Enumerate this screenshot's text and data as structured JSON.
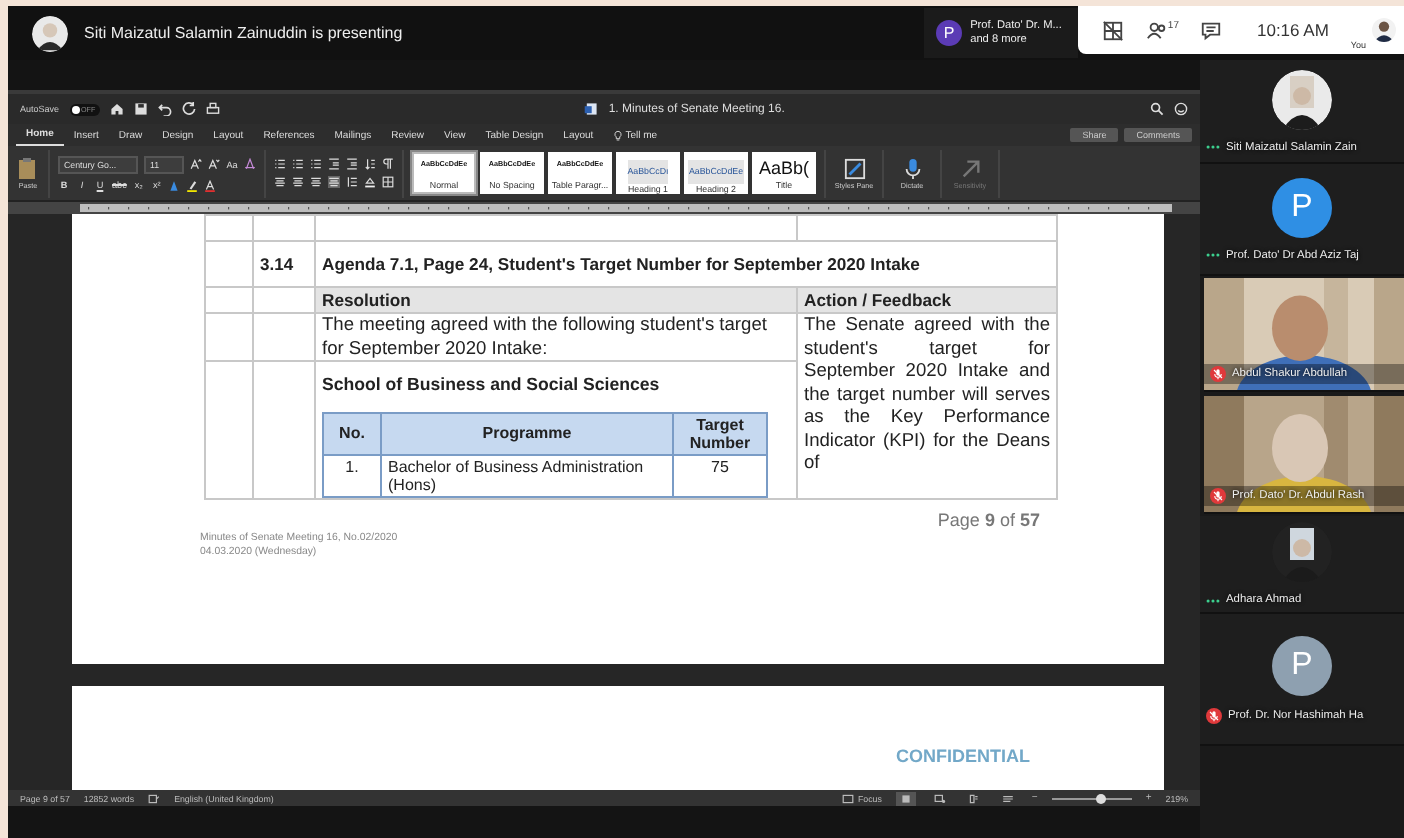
{
  "presenter_bar": {
    "text": "Siti Maizatul Salamin Zainuddin is presenting"
  },
  "speaker_chip": {
    "initial": "P",
    "name": "Prof. Dato' Dr. M...",
    "more": "and 8 more"
  },
  "meeting_controls": {
    "participant_count": "17",
    "time": "10:16 AM",
    "self_label": "You"
  },
  "word": {
    "title_bar": {
      "autosave_label": "AutoSave",
      "autosave": {
        "on": false,
        "label": "OFF"
      },
      "title": "1. Minutes of Senate Meeting 16."
    },
    "tabs": [
      {
        "label": "Home",
        "selected": true
      },
      {
        "label": "Insert",
        "selected": false
      },
      {
        "label": "Draw",
        "selected": false
      },
      {
        "label": "Design",
        "selected": false
      },
      {
        "label": "Layout",
        "selected": false
      },
      {
        "label": "References",
        "selected": false
      },
      {
        "label": "Mailings",
        "selected": false
      },
      {
        "label": "Review",
        "selected": false
      },
      {
        "label": "View",
        "selected": false
      },
      {
        "label": "Table Design",
        "selected": false
      },
      {
        "label": "Layout",
        "selected": false
      }
    ],
    "tell_me": "Tell me",
    "share": "Share",
    "comments": "Comments",
    "ribbon": {
      "paste": "Paste",
      "font": "Century Go...",
      "size": "11",
      "case": "Aa",
      "format_buttons": [
        "B",
        "I",
        "U",
        "abc",
        "x₂",
        "x²"
      ],
      "styles": [
        {
          "preview": "AaBbCcDdEe",
          "name": "Normal",
          "selected": true
        },
        {
          "preview": "AaBbCcDdEe",
          "name": "No Spacing",
          "selected": false
        },
        {
          "preview": "AaBbCcDdEe",
          "name": "Table Paragr...",
          "selected": false
        },
        {
          "preview": "AaBbCcDı",
          "name": "Heading 1",
          "selected": false
        },
        {
          "preview": "AaBbCcDdEe",
          "name": "Heading 2",
          "selected": false
        },
        {
          "preview": "AaBb(",
          "name": "Title",
          "selected": false
        }
      ],
      "styles_pane": "Styles Pane",
      "dictate": "Dictate",
      "sensitivity": "Sensitivity"
    },
    "document": {
      "agenda": {
        "number": "3.14",
        "title": "Agenda 7.1, Page 24, Student's Target Number for September 2020 Intake"
      },
      "resolution_heading": "Resolution",
      "action_heading": "Action / Feedback",
      "resolution_text": "The meeting agreed with the following student's target for September 2020 Intake:",
      "school": "School of Business and Social Sciences",
      "programme_table": {
        "columns": [
          "No.",
          "Programme",
          "Target Number"
        ],
        "rows": [
          [
            "1.",
            "Bachelor of Business Administration (Hons)",
            "75"
          ]
        ]
      },
      "action_text": "The Senate agreed with the student's target for September 2020 Intake and the target number will serves as the Key Performance Indicator (KPI) for the Deans of",
      "page_number": "Page **9** of **57**",
      "footer": [
        "Minutes of Senate Meeting 16, No.02/2020",
        "04.03.2020 (Wednesday)"
      ],
      "next_page_mark": "CONFIDENTIAL"
    },
    "status_bar": {
      "page": "Page 9 of 57",
      "words": "12852 words",
      "language": "English (United Kingdom)",
      "focus": "Focus",
      "views": [
        {
          "selected": true
        },
        {
          "selected": false
        },
        {
          "selected": false
        },
        {
          "selected": false
        }
      ],
      "zoom": {
        "minus": "−",
        "plus": "+",
        "level": 0.62,
        "reading": "219%"
      }
    }
  },
  "participants": [
    {
      "name": "Siti Maizatul Salamin Zain",
      "muted": false
    },
    {
      "name": "Prof. Dato' Dr Abd Aziz Taj",
      "kind": "initial",
      "initial": "P",
      "color": "#2f8fe4",
      "muted": false
    },
    {
      "name": "Abdul Shakur Abdullah",
      "kind": "video",
      "muted": true
    },
    {
      "name": "Prof. Dato' Dr. Abdul Rash",
      "kind": "video",
      "muted": true
    },
    {
      "name": "Adhara Ahmad",
      "muted": false
    },
    {
      "name": "Prof. Dr. Nor Hashimah Ha",
      "kind": "initial",
      "initial": "P",
      "color": "#8ea0b0",
      "muted": true
    }
  ]
}
